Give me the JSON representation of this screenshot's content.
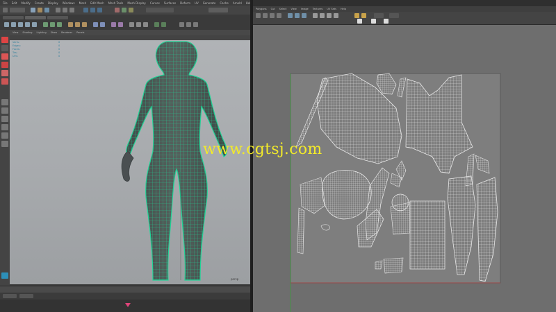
{
  "maya_window": {
    "menu": [
      "File",
      "Edit",
      "Modify",
      "Create",
      "Display",
      "Windows",
      "Mesh",
      "Edit Mesh",
      "Mesh Tools",
      "Mesh Display",
      "Curves",
      "Surfaces",
      "Deform",
      "UV",
      "Generate",
      "Cache",
      "Arnold",
      "Help"
    ],
    "viewport_menu": [
      "View",
      "Shading",
      "Lighting",
      "Show",
      "Renderer",
      "Panels"
    ],
    "hud_stats": [
      {
        "label": "Verts:",
        "a": "",
        "b": "",
        "c": "0"
      },
      {
        "label": "Edges:",
        "a": "",
        "b": "",
        "c": "0"
      },
      {
        "label": "Faces:",
        "a": "",
        "b": "",
        "c": "0"
      },
      {
        "label": "Tris:",
        "a": "",
        "b": "",
        "c": "0"
      },
      {
        "label": "UVs:",
        "a": "",
        "b": "",
        "c": "0"
      }
    ],
    "camera_label": "persp"
  },
  "uv_editor": {
    "menu": [
      "Polygons",
      "Cut",
      "Select",
      "View",
      "Image",
      "Textures",
      "UV Sets",
      "Help"
    ]
  },
  "watermark": "www.cgtsj.com",
  "colors": {
    "wireframe": "#20d496",
    "uv_lines": "#e8e8e8",
    "uv_tile": "#7e7e7e",
    "timeline_marker": "#e0447a",
    "watermark": "#f2ea2a"
  }
}
